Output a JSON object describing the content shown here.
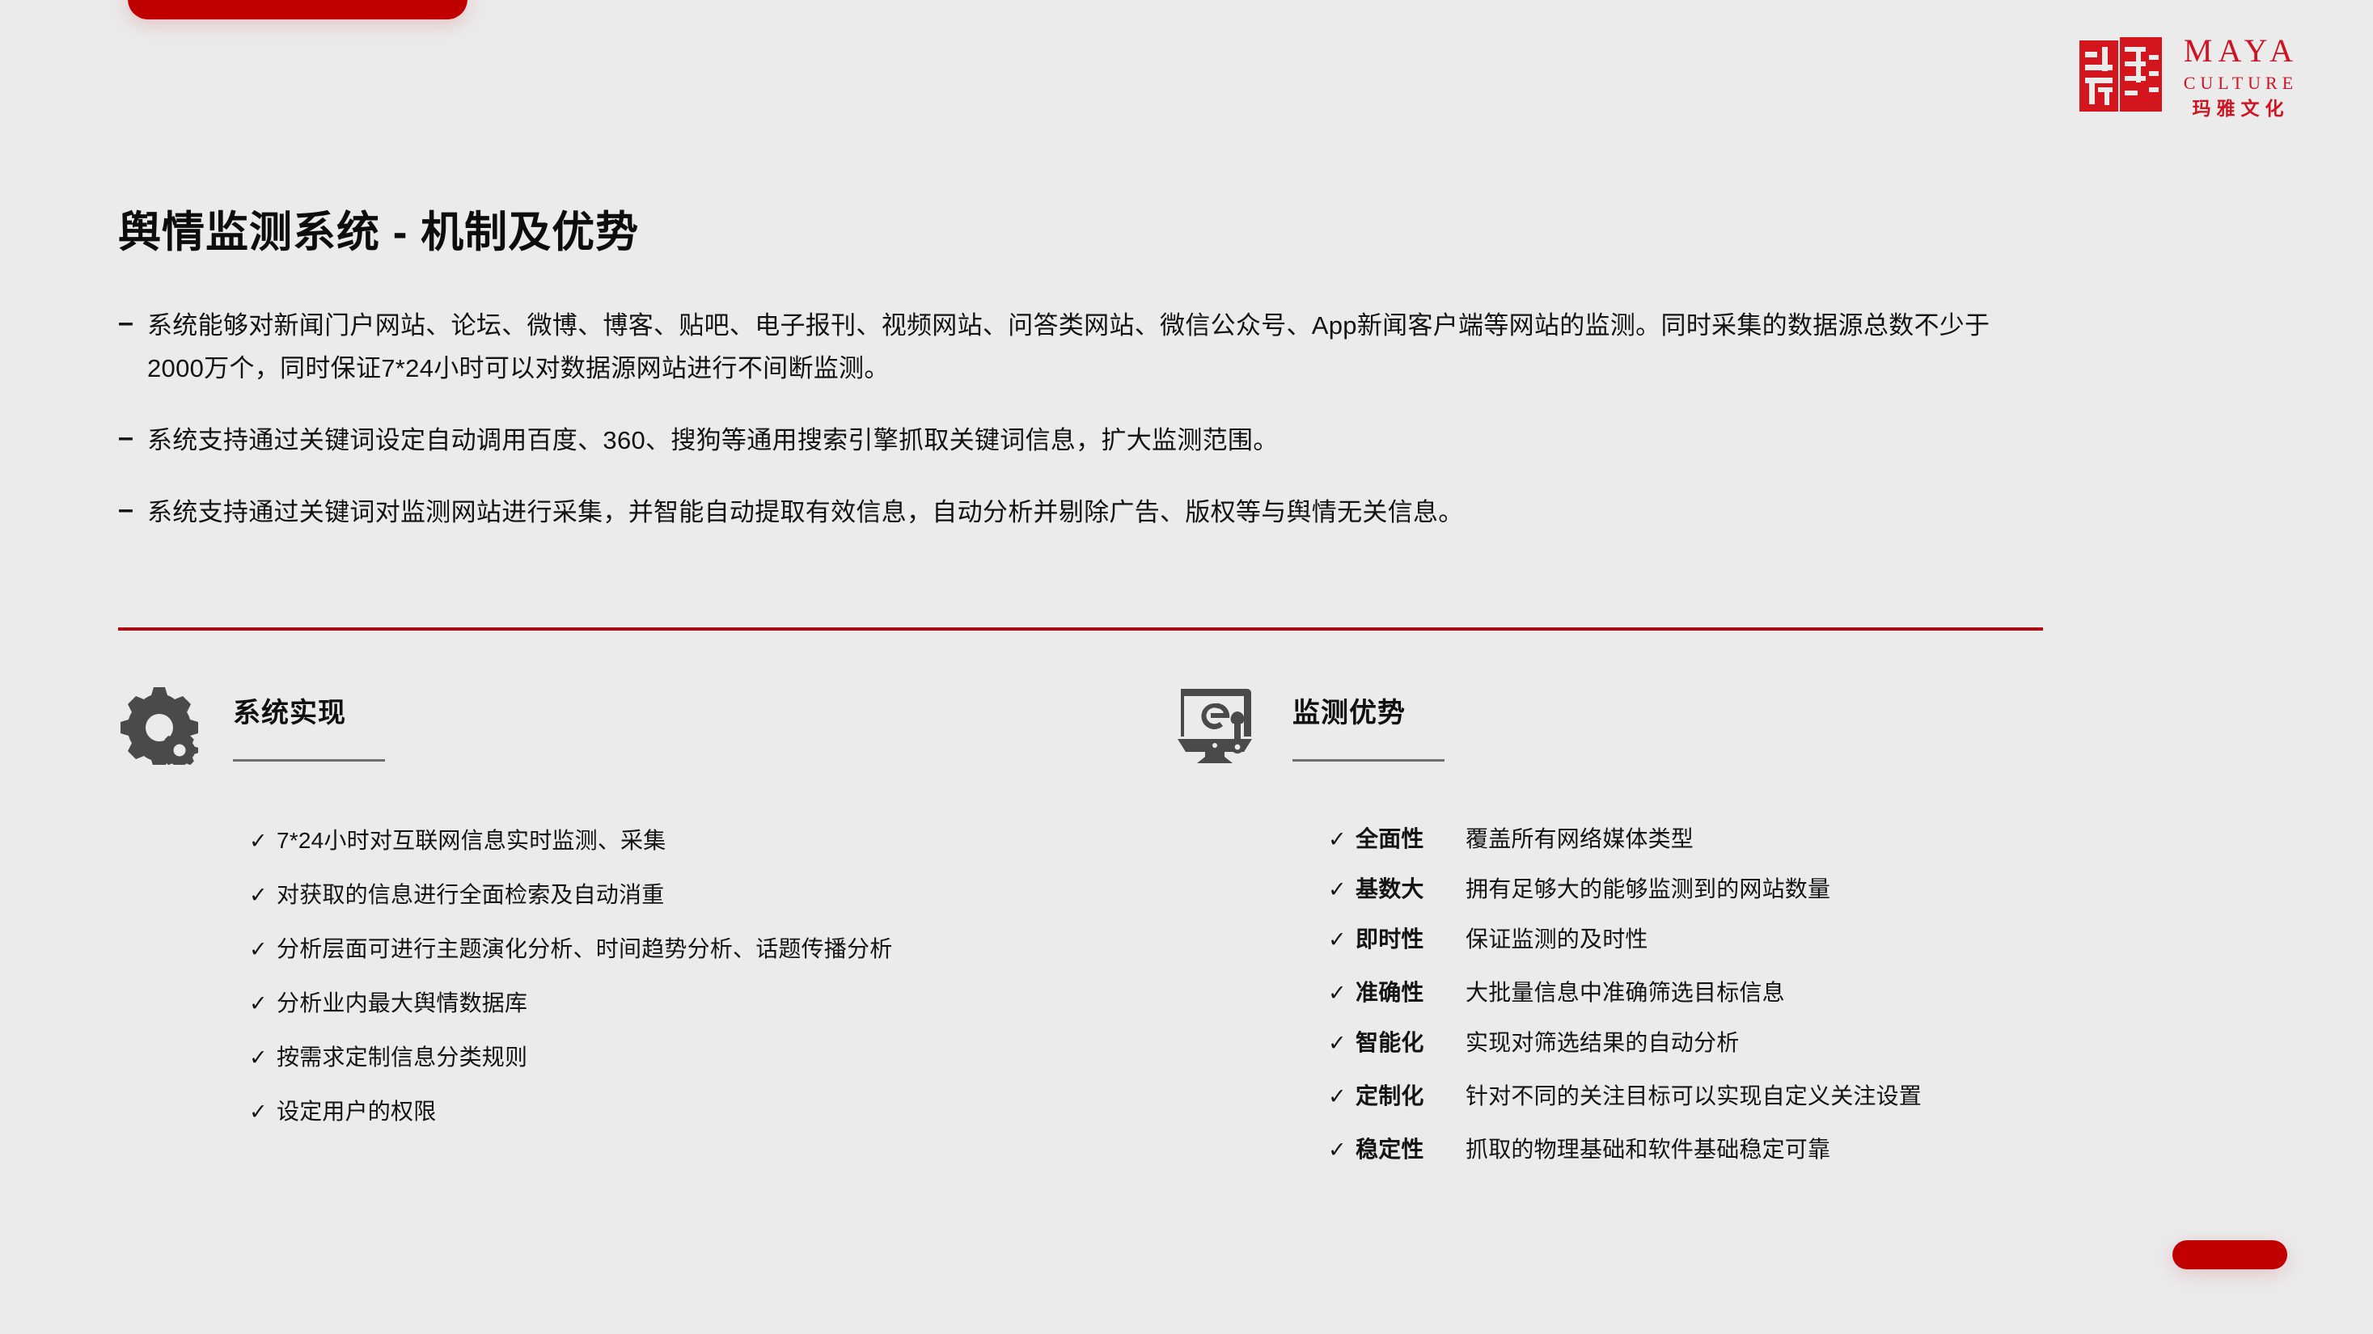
{
  "brand": {
    "seal_characters": "玛雅",
    "name_en": "MAYA",
    "subtitle_en": "CULTURE",
    "name_cn": "玛雅文化",
    "accent_color": "#cf1322"
  },
  "slide": {
    "title": "舆情监测系统 - 机制及优势",
    "divider_color": "#a80d13",
    "background_color": "#ebebec",
    "deco_bar_color": "#c00000"
  },
  "bullets": [
    {
      "marker": "–",
      "text": "系统能够对新闻门户网站、论坛、微博、博客、贴吧、电子报刊、视频网站、问答类网站、微信公众号、App新闻客户端等网站的监测。同时采集的数据源总数不少于2000万个，同时保证7*24小时可以对数据源网站进行不间断监测。"
    },
    {
      "marker": "–",
      "text": "系统支持通过关键词设定自动调用百度、360、搜狗等通用搜索引擎抓取关键词信息，扩大监测范围。"
    },
    {
      "marker": "–",
      "text": "系统支持通过关键词对监测网站进行采集，并智能自动提取有效信息，自动分析并剔除广告、版权等与舆情无关信息。"
    }
  ],
  "columns": {
    "left": {
      "icon": "gears-icon",
      "title": "系统实现",
      "items": [
        {
          "mark": "✓",
          "text": "7*24小时对互联网信息实时监测、采集"
        },
        {
          "mark": "✓",
          "text": "对获取的信息进行全面检索及自动消重"
        },
        {
          "mark": "✓",
          "text": "分析层面可进行主题演化分析、时间趋势分析、话题传播分析"
        },
        {
          "mark": "✓",
          "text": "分析业内最大舆情数据库"
        },
        {
          "mark": "✓",
          "text": "按需求定制信息分类规则"
        },
        {
          "mark": "✓",
          "text": "设定用户的权限"
        }
      ]
    },
    "right": {
      "icon": "monitor-wrench-icon",
      "title": "监测优势",
      "items": [
        {
          "mark": "✓",
          "term": "全面性",
          "desc": "覆盖所有网络媒体类型"
        },
        {
          "mark": "✓",
          "term": "基数大",
          "desc": "拥有足够大的能够监测到的网站数量"
        },
        {
          "mark": "✓",
          "term": "即时性",
          "desc": "保证监测的及时性"
        },
        {
          "mark": "✓",
          "term": "准确性",
          "desc": "大批量信息中准确筛选目标信息"
        },
        {
          "mark": "✓",
          "term": "智能化",
          "desc": "实现对筛选结果的自动分析"
        },
        {
          "mark": "✓",
          "term": "定制化",
          "desc": "针对不同的关注目标可以实现自定义关注设置"
        },
        {
          "mark": "✓",
          "term": "稳定性",
          "desc": "抓取的物理基础和软件基础稳定可靠"
        }
      ]
    }
  }
}
